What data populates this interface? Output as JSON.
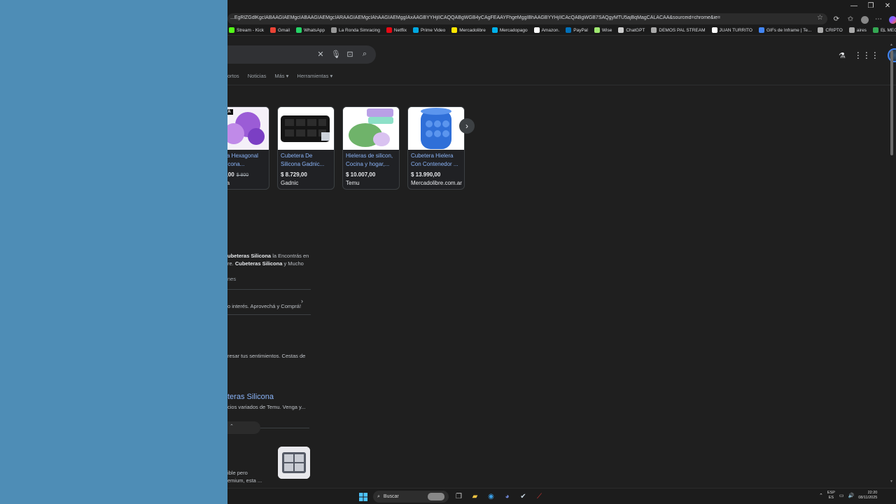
{
  "browser": {
    "url": "...EgRlZGdlKgcIABAAGIAEMgcIABAAGIAEMgcIARAAGIAEMgcIAhAAGIAEMggIAxAAGBYYHjIICAQQABgWGB4yCAgFEAAYFhgeMggIBhAAGBYYHjIICAcQABgWGB7SAQgyMTU5ajBqMagCALACAA&sourceid=chrome&ie=UTF-8",
    "bookmarks": [
      {
        "label": "Stream - Kick",
        "color": "#53fc18"
      },
      {
        "label": "Gmail",
        "color": "#ea4335"
      },
      {
        "label": "WhatsApp",
        "color": "#25d366"
      },
      {
        "label": "La Ronda Simracing",
        "color": "#999999"
      },
      {
        "label": "Netflix",
        "color": "#e50914"
      },
      {
        "label": "Prime Video",
        "color": "#00a8e1"
      },
      {
        "label": "Mercadolibre",
        "color": "#ffe600"
      },
      {
        "label": "Mercadopago",
        "color": "#00b1ea"
      },
      {
        "label": "Amazon.",
        "color": "#ffffff"
      },
      {
        "label": "PayPal",
        "color": "#0070ba"
      },
      {
        "label": "Wise",
        "color": "#9fe870"
      },
      {
        "label": "ChatGPT",
        "color": "#cccccc"
      },
      {
        "label": "DEMOS PAL STREAM",
        "color": "#aaaaaa"
      },
      {
        "label": "JUAN TURRITO",
        "color": "#ffffff"
      },
      {
        "label": "GIFs de Inframe | Te...",
        "color": "#4285f4"
      },
      {
        "label": "CRIPTO",
        "color": "#aaaaaa"
      },
      {
        "label": "aires",
        "color": "#aaaaaa"
      },
      {
        "label": "EL MEGA PACK PAP...",
        "color": "#34a853"
      }
    ]
  },
  "tabs": [
    "ortos",
    "Noticias",
    "Más ▾",
    "Herramientas ▾"
  ],
  "products": [
    {
      "title": "...tera Hexagonal ...Silicona...",
      "price": "...80,00",
      "old_price": "$ 800",
      "store": "...ega",
      "badge": "...TA"
    },
    {
      "title": "Cubetera De Silicona Gadnic...",
      "price": "$ 8.729,00",
      "store": "Gadnic"
    },
    {
      "title": "Hieleras de silicon, Cocina y hogar,...",
      "price": "$ 10.007,00",
      "store": "Temu"
    },
    {
      "title": "Cubetera Hielera Con Contenedor ...",
      "price": "$ 13.990,00",
      "store": "Mercadolibre.com.ar"
    }
  ],
  "results": {
    "snippet1_a_bold": "ubeteras Silicona",
    "snippet1_a": " la Encontrás en",
    "snippet1_b": "re. ",
    "snippet1_b_bold": "Cubeteras Silicona",
    "snippet1_b_end": " y Mucho",
    "snippet1_c": "nes",
    "snippet2": "o interés. Aprovechá y Comprá!",
    "snippet3": "resar tus sentimientos. Cestas de",
    "title4": "teras Silicona",
    "snippet4": "cios variados de Temu. Venga y...",
    "snippet5_a": "ible pero",
    "snippet5_b": "emium, esta ..."
  },
  "taskbar": {
    "search_label": "Buscar",
    "lang_top": "ESP",
    "lang_bottom": "ES",
    "time": "22:20",
    "date": "08/11/2025"
  }
}
